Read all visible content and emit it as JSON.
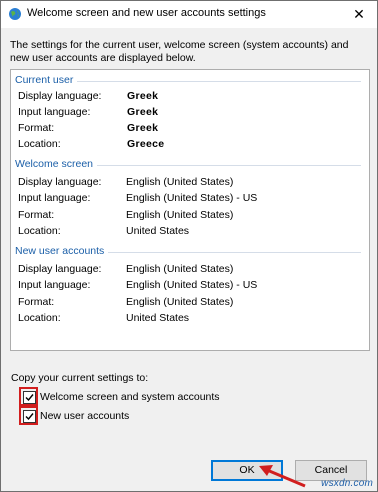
{
  "window": {
    "title": "Welcome screen and new user accounts settings",
    "close_glyph": "✕"
  },
  "intro": "The settings for the current user, welcome screen (system accounts) and new user accounts are displayed below.",
  "groups": [
    {
      "title": "Current user",
      "rows": [
        {
          "label": "Display language:",
          "value": "Greek"
        },
        {
          "label": "Input language:",
          "value": "Greek"
        },
        {
          "label": "Format:",
          "value": "Greek"
        },
        {
          "label": "Location:",
          "value": "Greece"
        }
      ]
    },
    {
      "title": "Welcome screen",
      "rows": [
        {
          "label": "Display language:",
          "value": "English (United States)"
        },
        {
          "label": "Input language:",
          "value": "English (United States) - US"
        },
        {
          "label": "Format:",
          "value": "English (United States)"
        },
        {
          "label": "Location:",
          "value": "United States"
        }
      ]
    },
    {
      "title": "New user accounts",
      "rows": [
        {
          "label": "Display language:",
          "value": "English (United States)"
        },
        {
          "label": "Input language:",
          "value": "English (United States) - US"
        },
        {
          "label": "Format:",
          "value": "English (United States)"
        },
        {
          "label": "Location:",
          "value": "United States"
        }
      ]
    }
  ],
  "copy": {
    "label": "Copy your current settings to:",
    "options": [
      {
        "label": "Welcome screen and system accounts",
        "checked": true
      },
      {
        "label": "New user accounts",
        "checked": true
      }
    ]
  },
  "buttons": {
    "ok": "OK",
    "cancel": "Cancel"
  },
  "watermark": "wsxdn.com",
  "colors": {
    "highlight_red": "#d11e1e",
    "group_heading": "#1b5fa8",
    "default_button_border": "#0078d7"
  },
  "icons": {
    "title": "globe-icon",
    "close": "close-icon",
    "check": "checkmark-icon",
    "annotation": "red-arrow-icon"
  }
}
